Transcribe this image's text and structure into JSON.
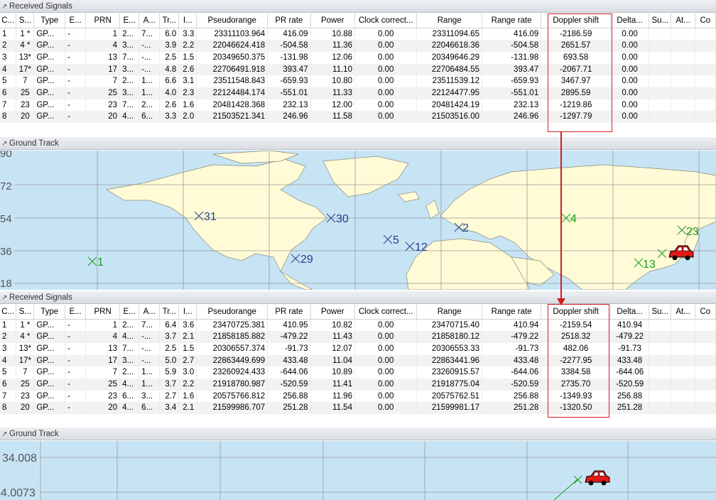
{
  "panels": {
    "received_title_1": "Received Signals",
    "ground_title_1": "Ground Track",
    "received_title_2": "Received Signals",
    "ground_title_2": "Ground Track"
  },
  "columns": [
    "C...",
    "S...",
    "Type",
    "E...",
    "PRN",
    "E...",
    "A...",
    "Tr...",
    "I...",
    "Pseudorange",
    "PR rate",
    "Power",
    "Clock correct...",
    "Range",
    "Range rate",
    "Doppler shift",
    "Delta...",
    "Su...",
    "At...",
    "Co"
  ],
  "table1": [
    [
      "1",
      "1 *",
      "GP...",
      "-",
      "1",
      "2...",
      "7...",
      "6.0",
      "3.3",
      "23311103.964",
      "416.09",
      "10.88",
      "0.00",
      "23311094.65",
      "416.09",
      "-2186.59",
      "0.00"
    ],
    [
      "2",
      "4 *",
      "GP...",
      "-",
      "4",
      "3...",
      "-...",
      "3.9",
      "2.2",
      "22046624.418",
      "-504.58",
      "11.36",
      "0.00",
      "22046618.36",
      "-504.58",
      "2651.57",
      "0.00"
    ],
    [
      "3",
      "13*",
      "GP...",
      "-",
      "13",
      "7...",
      "-...",
      "2.5",
      "1.5",
      "20349650.375",
      "-131.98",
      "12.06",
      "0.00",
      "20349646.29",
      "-131.98",
      "693.58",
      "0.00"
    ],
    [
      "4",
      "17*",
      "GP...",
      "-",
      "17",
      "3...",
      "-...",
      "4.8",
      "2.6",
      "22706491.918",
      "393.47",
      "11.10",
      "0.00",
      "22706484.55",
      "393.47",
      "-2067.71",
      "0.00"
    ],
    [
      "5",
      "7",
      "GP...",
      "-",
      "7",
      "2...",
      "1...",
      "6.6",
      "3.1",
      "23511548.843",
      "-659.93",
      "10.80",
      "0.00",
      "23511539.12",
      "-659.93",
      "3467.97",
      "0.00"
    ],
    [
      "6",
      "25",
      "GP...",
      "-",
      "25",
      "3...",
      "1...",
      "4.0",
      "2.3",
      "22124484.174",
      "-551.01",
      "11.33",
      "0.00",
      "22124477.95",
      "-551.01",
      "2895.59",
      "0.00"
    ],
    [
      "7",
      "23",
      "GP...",
      "-",
      "23",
      "7...",
      "2...",
      "2.6",
      "1.6",
      "20481428.368",
      "232.13",
      "12.00",
      "0.00",
      "20481424.19",
      "232.13",
      "-1219.86",
      "0.00"
    ],
    [
      "8",
      "20",
      "GP...",
      "-",
      "20",
      "4...",
      "6...",
      "3.3",
      "2.0",
      "21503521.341",
      "246.96",
      "11.58",
      "0.00",
      "21503516.00",
      "246.96",
      "-1297.79",
      "0.00"
    ]
  ],
  "table2": [
    [
      "1",
      "1 *",
      "GP...",
      "-",
      "1",
      "2...",
      "7...",
      "6.4",
      "3.6",
      "23470725.381",
      "410.95",
      "10.82",
      "0.00",
      "23470715.40",
      "410.94",
      "-2159.54",
      "410.94"
    ],
    [
      "2",
      "4 *",
      "GP...",
      "-",
      "4",
      "4...",
      "-...",
      "3.7",
      "2.1",
      "21858185.882",
      "-479.22",
      "11.43",
      "0.00",
      "21858180.12",
      "-479.22",
      "2518.32",
      "-479.22"
    ],
    [
      "3",
      "13*",
      "GP...",
      "-",
      "13",
      "7...",
      "-...",
      "2.5",
      "1.5",
      "20306557.374",
      "-91.73",
      "12.07",
      "0.00",
      "20306553.33",
      "-91.73",
      "482.06",
      "-91.73"
    ],
    [
      "4",
      "17*",
      "GP...",
      "-",
      "17",
      "3...",
      "-...",
      "5.0",
      "2.7",
      "22863449.699",
      "433.48",
      "11.04",
      "0.00",
      "22863441.96",
      "433.48",
      "-2277.95",
      "433.48"
    ],
    [
      "5",
      "7",
      "GP...",
      "-",
      "7",
      "2...",
      "1...",
      "5.9",
      "3.0",
      "23260924.433",
      "-644.06",
      "10.89",
      "0.00",
      "23260915.57",
      "-644.06",
      "3384.58",
      "-644.06"
    ],
    [
      "6",
      "25",
      "GP...",
      "-",
      "25",
      "4...",
      "1...",
      "3.7",
      "2.2",
      "21918780.987",
      "-520.59",
      "11.41",
      "0.00",
      "21918775.04",
      "-520.59",
      "2735.70",
      "-520.59"
    ],
    [
      "7",
      "23",
      "GP...",
      "-",
      "23",
      "6...",
      "3...",
      "2.7",
      "1.6",
      "20575766.812",
      "256.88",
      "11.96",
      "0.00",
      "20575762.51",
      "256.88",
      "-1349.93",
      "256.88"
    ],
    [
      "8",
      "20",
      "GP...",
      "-",
      "20",
      "4...",
      "6...",
      "3.4",
      "2.1",
      "21599986.707",
      "251.28",
      "11.54",
      "0.00",
      "21599981.17",
      "251.28",
      "-1320.50",
      "251.28"
    ]
  ],
  "map": {
    "lat_labels": [
      "90",
      "72",
      "54",
      "36",
      "18"
    ],
    "satellites": [
      {
        "label": "1",
        "color": "#1a9b1a"
      },
      {
        "label": "31",
        "color": "#283c8c"
      },
      {
        "label": "29",
        "color": "#283c8c"
      },
      {
        "label": "30",
        "color": "#283c8c"
      },
      {
        "label": "5",
        "color": "#283c8c"
      },
      {
        "label": "12",
        "color": "#283c8c"
      },
      {
        "label": "2",
        "color": "#283c8c"
      },
      {
        "label": "4",
        "color": "#1a9b1a"
      },
      {
        "label": "23",
        "color": "#1a9b1a"
      },
      {
        "label": "13",
        "color": "#1a9b1a"
      }
    ]
  },
  "track2": {
    "y_labels": [
      "34.008",
      "34.0073"
    ]
  },
  "colors": {
    "highlight": "#d31c1c",
    "ocean": "#c7e4f5",
    "land": "#fffbd6"
  }
}
